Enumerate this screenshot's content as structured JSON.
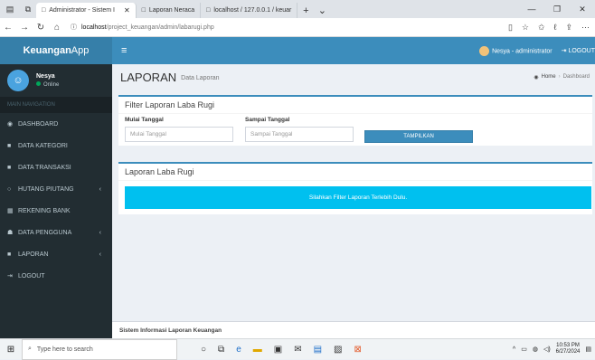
{
  "browser": {
    "tabs": [
      {
        "label": "Administrator - Sistem I"
      },
      {
        "label": "Laporan Neraca"
      },
      {
        "label": "localhost / 127.0.0.1 / keuar"
      }
    ],
    "url_host": "localhost",
    "url_path": "/project_keuangan/admin/labarugi.php",
    "url_icon": "info-icon"
  },
  "header": {
    "logo_prefix": "Keuangan",
    "logo_suffix": "App",
    "user_label": "Nesya - administrator",
    "logout_label": "LOGOUT"
  },
  "sidebar": {
    "user_name": "Nesya",
    "user_status": "Online",
    "nav_header": "MAIN NAVIGATION",
    "items": [
      {
        "label": "DASHBOARD",
        "icon": "dashboard-icon"
      },
      {
        "label": "DATA KATEGORI",
        "icon": "folder-icon"
      },
      {
        "label": "DATA TRANSAKSI",
        "icon": "folder-icon"
      },
      {
        "label": "HUTANG PIUTANG",
        "icon": "circle-icon"
      },
      {
        "label": "REKENING BANK",
        "icon": "bank-icon"
      },
      {
        "label": "DATA PENGGUNA",
        "icon": "users-icon"
      },
      {
        "label": "LAPORAN",
        "icon": "folder-icon"
      },
      {
        "label": "LOGOUT",
        "icon": "logout-icon"
      }
    ]
  },
  "content": {
    "title": "LAPORAN",
    "subtitle": "Data Laporan",
    "breadcrumb_home": "Home",
    "breadcrumb_current": "Dashboard",
    "filter_title": "Filter Laporan Laba Rugi",
    "start_label": "Mulai Tanggal",
    "start_placeholder": "Mulai Tanggal",
    "end_label": "Sampai Tanggal",
    "end_placeholder": "Sampai Tanggal",
    "submit_label": "TAMPILKAN",
    "report_title": "Laporan Laba Rugi",
    "info_message": "Silahkan Filter Laporan Terlebih Dulu."
  },
  "footer": {
    "text": "Sistem Informasi Laporan Keuangan"
  },
  "taskbar": {
    "search_placeholder": "Type here to search",
    "time": "10:53 PM",
    "date": "6/27/2024"
  },
  "colors": {
    "primary": "#3c8dbc",
    "info": "#00c0ef",
    "sidebar": "#222d32"
  }
}
